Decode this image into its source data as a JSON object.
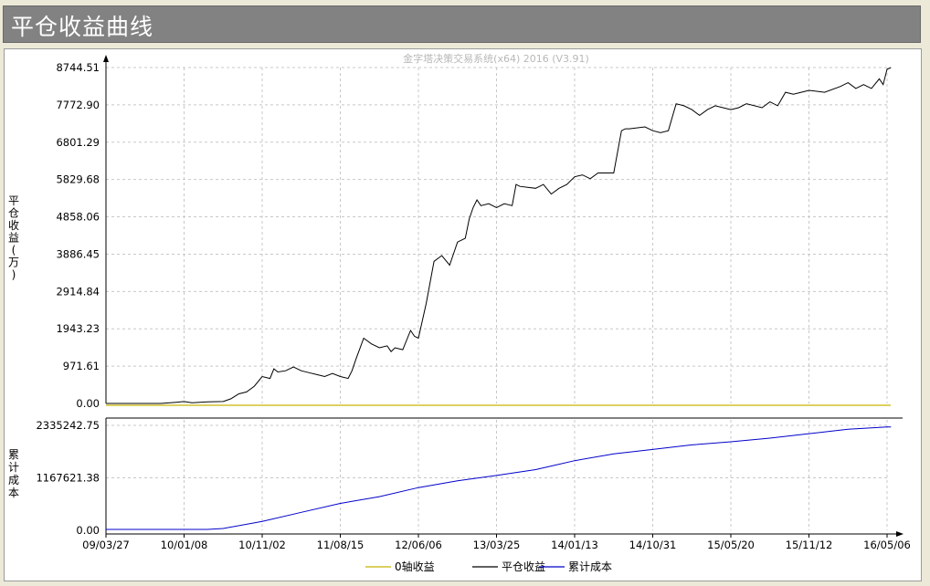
{
  "header": {
    "title": "平仓收益曲线"
  },
  "chart_data": [
    {
      "type": "line",
      "watermark": "金字塔决策交易系统(x64) 2016 (V3.91)",
      "ylabel": "平仓收益(万)",
      "y_tick_labels": [
        "0.00",
        "971.61",
        "1943.23",
        "2914.84",
        "3886.45",
        "4858.06",
        "5829.68",
        "6801.29",
        "7772.90",
        "8744.51"
      ],
      "ylim": [
        0,
        8744.51
      ],
      "x_tick_labels": [
        "09/03/27",
        "10/01/08",
        "10/11/02",
        "11/08/15",
        "12/06/06",
        "13/03/25",
        "14/01/13",
        "14/10/31",
        "15/05/20",
        "15/11/12",
        "16/05/06"
      ],
      "grid": true,
      "series": [
        {
          "name": "0轴收益",
          "color": "#c8b400",
          "x": [
            0,
            10.05
          ],
          "values": [
            0,
            0
          ]
        },
        {
          "name": "平仓收益",
          "color": "#000000",
          "x": [
            0,
            0.5,
            0.7,
            0.9,
            1.0,
            1.1,
            1.3,
            1.5,
            1.6,
            1.7,
            1.8,
            1.9,
            2.0,
            2.1,
            2.15,
            2.2,
            2.3,
            2.4,
            2.5,
            2.6,
            2.7,
            2.8,
            2.9,
            3.0,
            3.1,
            3.15,
            3.2,
            3.3,
            3.4,
            3.5,
            3.6,
            3.65,
            3.7,
            3.8,
            3.9,
            3.95,
            4.0,
            4.1,
            4.2,
            4.3,
            4.4,
            4.5,
            4.6,
            4.65,
            4.7,
            4.75,
            4.8,
            4.9,
            5.0,
            5.1,
            5.2,
            5.25,
            5.3,
            5.5,
            5.6,
            5.7,
            5.8,
            5.9,
            6.0,
            6.1,
            6.2,
            6.3,
            6.5,
            6.6,
            6.65,
            6.7,
            6.9,
            7.0,
            7.1,
            7.2,
            7.3,
            7.4,
            7.5,
            7.6,
            7.7,
            7.8,
            7.9,
            8.0,
            8.1,
            8.2,
            8.4,
            8.5,
            8.6,
            8.7,
            8.8,
            8.9,
            9.0,
            9.2,
            9.4,
            9.5,
            9.6,
            9.7,
            9.8,
            9.9,
            9.95,
            10.0,
            10.05
          ],
          "values": [
            0,
            0,
            0,
            30,
            50,
            20,
            40,
            50,
            120,
            250,
            300,
            450,
            700,
            650,
            900,
            820,
            850,
            950,
            850,
            800,
            750,
            700,
            780,
            700,
            650,
            850,
            1150,
            1700,
            1550,
            1450,
            1500,
            1350,
            1450,
            1400,
            1900,
            1750,
            1700,
            2600,
            3700,
            3850,
            3600,
            4200,
            4300,
            4800,
            5100,
            5300,
            5150,
            5200,
            5100,
            5200,
            5150,
            5700,
            5650,
            5600,
            5700,
            5450,
            5600,
            5700,
            5900,
            5950,
            5850,
            6000,
            6000,
            7100,
            7150,
            7150,
            7200,
            7100,
            7050,
            7100,
            7800,
            7750,
            7650,
            7500,
            7650,
            7750,
            7700,
            7650,
            7700,
            7800,
            7700,
            7850,
            7750,
            8100,
            8050,
            8100,
            8150,
            8100,
            8250,
            8350,
            8200,
            8300,
            8200,
            8450,
            8300,
            8700,
            8744.51
          ]
        }
      ]
    },
    {
      "type": "line",
      "ylabel": "累计成本",
      "y_tick_labels": [
        "0.00",
        "1167621.38",
        "2335242.75"
      ],
      "ylim": [
        0,
        2335242.75
      ],
      "x_tick_labels": [
        "09/03/27",
        "10/01/08",
        "10/11/02",
        "11/08/15",
        "12/06/06",
        "13/03/25",
        "14/01/13",
        "14/10/31",
        "15/05/20",
        "15/11/12",
        "16/05/06"
      ],
      "grid": true,
      "series": [
        {
          "name": "累计成本",
          "color": "#0000cc",
          "x": [
            0,
            0.5,
            1.0,
            1.3,
            1.5,
            2.0,
            2.5,
            3.0,
            3.5,
            4.0,
            4.5,
            5.0,
            5.5,
            6.0,
            6.5,
            7.0,
            7.5,
            8.0,
            8.5,
            9.0,
            9.5,
            10.0,
            10.05
          ],
          "values": [
            20000,
            20000,
            20000,
            20000,
            40000,
            200000,
            400000,
            600000,
            750000,
            950000,
            1100000,
            1220000,
            1350000,
            1550000,
            1700000,
            1800000,
            1900000,
            1970000,
            2050000,
            2150000,
            2250000,
            2300000,
            2300000
          ]
        }
      ]
    }
  ],
  "legend": [
    {
      "label": "0轴收益",
      "color": "#c8b400"
    },
    {
      "label": "平仓收益",
      "color": "#000000"
    },
    {
      "label": "累计成本",
      "color": "#0000cc"
    }
  ]
}
